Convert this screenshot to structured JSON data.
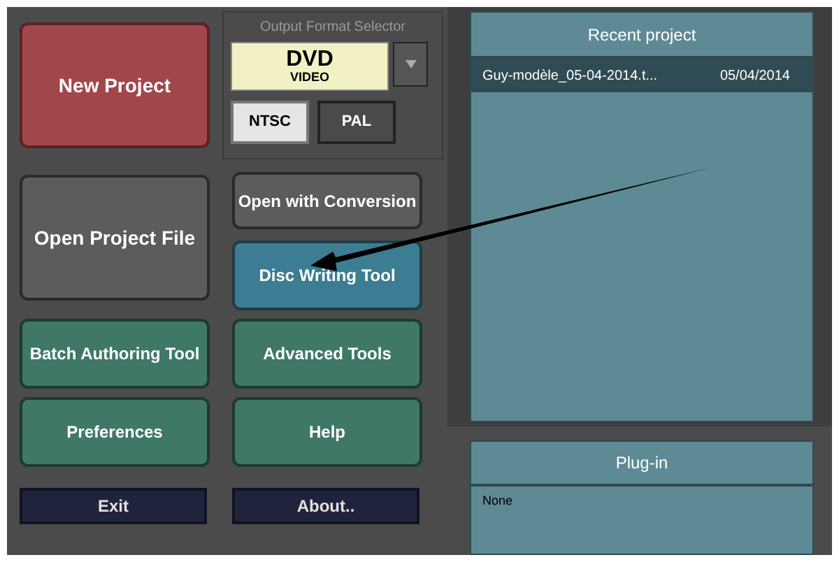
{
  "main_buttons": [
    {
      "label": "New Project",
      "kind": "red"
    },
    {
      "label": "Open with Conversion",
      "kind": "gray"
    },
    {
      "label": "Open Project File",
      "kind": "gray"
    },
    {
      "label": "Disc Writing Tool",
      "kind": "blue"
    },
    {
      "label": "Batch Authoring Tool",
      "kind": "green"
    },
    {
      "label": "Advanced Tools",
      "kind": "green"
    },
    {
      "label": "Preferences",
      "kind": "green"
    },
    {
      "label": "Help",
      "kind": "green"
    },
    {
      "label": "Exit",
      "kind": "navy"
    },
    {
      "label": "About..",
      "kind": "navy"
    }
  ],
  "output_format": {
    "title": "Output Format Selector",
    "format_top": "DVD",
    "format_bottom": "VIDEO",
    "standards": [
      {
        "label": "NTSC",
        "selected": true
      },
      {
        "label": "PAL",
        "selected": false
      }
    ]
  },
  "recent_project": {
    "title": "Recent project",
    "rows": [
      {
        "name": "Guy-modèle_05-04-2014.t...",
        "date": "05/04/2014",
        "selected": true
      }
    ]
  },
  "plugin": {
    "title": "Plug-in",
    "value": "None"
  }
}
